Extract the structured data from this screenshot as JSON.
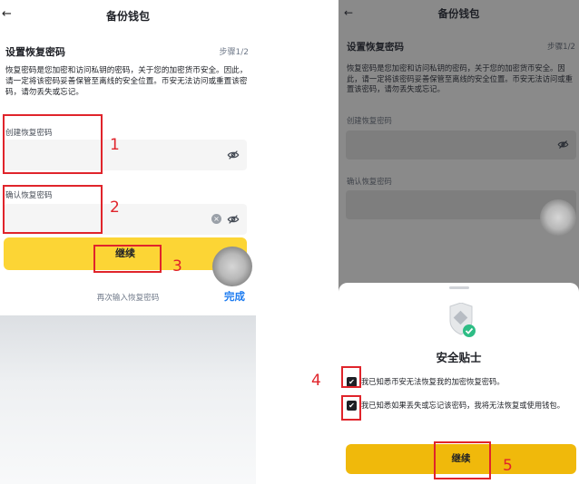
{
  "left": {
    "back_glyph": "←",
    "title": "备份钱包",
    "section_title": "设置恢复密码",
    "step": "步骤1/2",
    "description": "恢复密码是您加密和访问私钥的密码，关于您的加密货币安全。因此，请一定将该密码妥善保管至离线的安全位置。币安无法访问或重置该密码，请勿丢失或忘记。",
    "create_label": "创建恢复密码",
    "confirm_label": "确认恢复密码",
    "continue_label": "继续",
    "hint": "再次输入恢复密码",
    "done_label": "完成"
  },
  "right": {
    "back_glyph": "←",
    "title": "备份钱包",
    "section_title": "设置恢复密码",
    "step": "步骤1/2",
    "description": "恢复密码是您加密和访问私钥的密码，关于您的加密货币安全。因此，请一定将该密码妥善保管至离线的安全位置。币安无法访问或重置该密码，请勿丢失或忘记。",
    "create_label": "创建恢复密码",
    "confirm_label": "确认恢复密码",
    "sheet": {
      "title": "安全贴士",
      "check1": "我已知悉币安无法恢复我的加密恢复密码。",
      "check2": "我已知悉如果丢失或忘记该密码，我将无法恢复或使用钱包。",
      "continue_label": "继续"
    }
  },
  "annotations": [
    "1",
    "2",
    "3",
    "4",
    "5"
  ],
  "colors": {
    "brand_yellow": "#fcd535",
    "button_yellow_dimmed": "#f0b90b",
    "annotation_red": "#e0242b",
    "done_blue": "#1e7cf0",
    "check_green": "#2ebd85"
  },
  "icons": [
    "back-arrow-icon",
    "eye-off-icon",
    "clear-icon",
    "shield-check-icon",
    "checkbox-checked-icon"
  ]
}
